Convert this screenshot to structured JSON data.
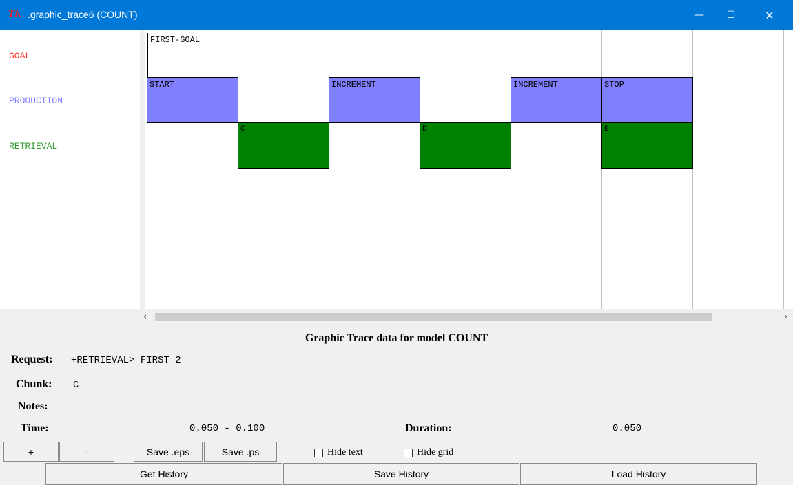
{
  "window": {
    "title": ".graphic_trace6 (COUNT)",
    "logo": "Tk",
    "minimize_glyph": "—",
    "maximize_glyph": "☐",
    "close_glyph": "✕"
  },
  "colors": {
    "goal": "#ff3333",
    "production": "#8080ff",
    "retrieval": "#008000",
    "titlebar": "#0078d7"
  },
  "rows": {
    "goal": "GOAL",
    "production": "PRODUCTION",
    "retrieval": "RETRIEVAL"
  },
  "events": {
    "goal": [
      "FIRST-GOAL"
    ],
    "production": [
      "START",
      "INCREMENT",
      "INCREMENT",
      "STOP"
    ],
    "retrieval": [
      "C",
      "D",
      "E"
    ]
  },
  "scroll": {
    "left_arrow": "‹",
    "right_arrow": "›"
  },
  "info": {
    "caption": "Graphic Trace data for model COUNT",
    "request_label": "Request:",
    "request_value": "+RETRIEVAL> FIRST 2",
    "chunk_label": "Chunk:",
    "chunk_value": "C",
    "notes_label": "Notes:",
    "time_label": "Time:",
    "time_value": "0.050 - 0.100",
    "duration_label": "Duration:",
    "duration_value": "0.050"
  },
  "controls": {
    "zoom_in": "+",
    "zoom_out": "-",
    "save_eps": "Save .eps",
    "save_ps": "Save .ps",
    "hide_text": "Hide text",
    "hide_grid": "Hide grid",
    "get_history": "Get History",
    "save_history": "Save History",
    "load_history": "Load History"
  }
}
